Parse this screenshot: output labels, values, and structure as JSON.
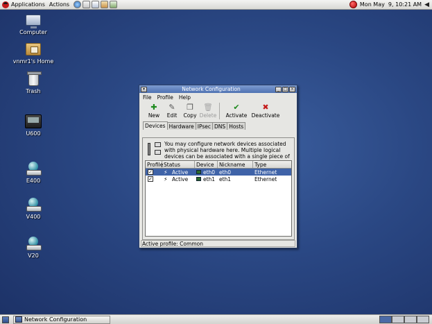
{
  "top_panel": {
    "applications": "Applications",
    "actions": "Actions",
    "clock": "Mon May  9, 10:21 AM"
  },
  "desktop_icons": [
    {
      "label": "Computer"
    },
    {
      "label": "vnmr1's Home"
    },
    {
      "label": "Trash"
    },
    {
      "label": "U600"
    },
    {
      "label": "E400"
    },
    {
      "label": "V400"
    },
    {
      "label": "V20"
    }
  ],
  "window": {
    "title": "Network Configuration",
    "menus": [
      "File",
      "Profile",
      "Help"
    ],
    "toolbar": [
      {
        "label": "New",
        "icon": "new-icon",
        "enabled": true
      },
      {
        "label": "Edit",
        "icon": "edit-icon",
        "enabled": true
      },
      {
        "label": "Copy",
        "icon": "copy-icon",
        "enabled": true
      },
      {
        "label": "Delete",
        "icon": "delete-icon",
        "enabled": false
      },
      {
        "label": "Activate",
        "icon": "check-icon",
        "enabled": true,
        "color": "#1d8a1d"
      },
      {
        "label": "Deactivate",
        "icon": "x-icon",
        "enabled": true,
        "color": "#c41a1a"
      }
    ],
    "tabs": [
      "Devices",
      "Hardware",
      "IPsec",
      "DNS",
      "Hosts"
    ],
    "active_tab": "Devices",
    "info_text": "You may configure network devices associated with physical hardware here.  Multiple logical devices can be associated with a single piece of hardware.",
    "table": {
      "columns": [
        "Profile",
        "Status",
        "Device",
        "Nickname",
        "Type"
      ],
      "rows": [
        {
          "profile": "☑",
          "status": "Active",
          "device": "eth0",
          "nickname": "eth0",
          "type": "Ethernet",
          "selected": true
        },
        {
          "profile": "☑",
          "status": "Active",
          "device": "eth1",
          "nickname": "eth1",
          "type": "Ethernet",
          "selected": false
        }
      ]
    },
    "status_bar": "Active profile: Common"
  },
  "bottom_panel": {
    "task": "Network Configuration"
  },
  "colors": {
    "desktop": "#2a4783",
    "titlebar": "#5a7cbc",
    "selection": "#3f63a8"
  }
}
